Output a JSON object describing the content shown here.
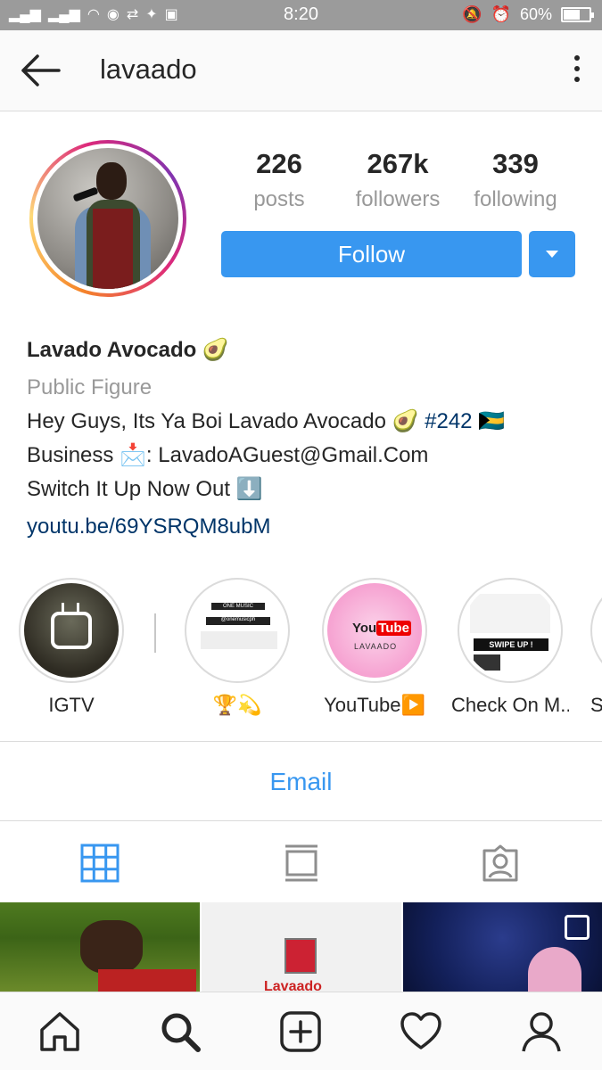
{
  "status": {
    "time": "8:20",
    "battery": "60%"
  },
  "topbar": {
    "username": "lavaado"
  },
  "stats": {
    "posts": {
      "value": "226",
      "label": "posts"
    },
    "followers": {
      "value": "267k",
      "label": "followers"
    },
    "following": {
      "value": "339",
      "label": "following"
    }
  },
  "follow_button": "Follow",
  "bio": {
    "name": "Lavado Avocado 🥑",
    "category": "Public Figure",
    "line1_text": "Hey Guys, Its Ya Boi Lavado Avocado 🥑 ",
    "line1_tag": "#242",
    "line1_flag": " 🇧🇸",
    "line2": "Business 📩: LavadoAGuest@Gmail.Com",
    "line3": "Switch It Up Now Out ⬇️",
    "link": "youtu.be/69YSRQM8ubM"
  },
  "highlights": [
    {
      "label": "IGTV"
    },
    {
      "label": "🏆💫"
    },
    {
      "label": "YouTube▶️"
    },
    {
      "label": "Check On M..."
    },
    {
      "label": "S"
    }
  ],
  "highlight_content": {
    "news_handle": "@onemusicph",
    "news_brand": "ONE MUSIC",
    "yt_logo_a": "You",
    "yt_logo_b": "Tube",
    "yt_sub": "LAVAADO",
    "swipe": "SWIPE UP !"
  },
  "email_button": "Email",
  "grid": {
    "cell2_word": "Lavaado"
  },
  "colors": {
    "accent": "#3897f0",
    "link": "#003569",
    "muted": "#999999",
    "statusbar": "#9b9b9b"
  }
}
